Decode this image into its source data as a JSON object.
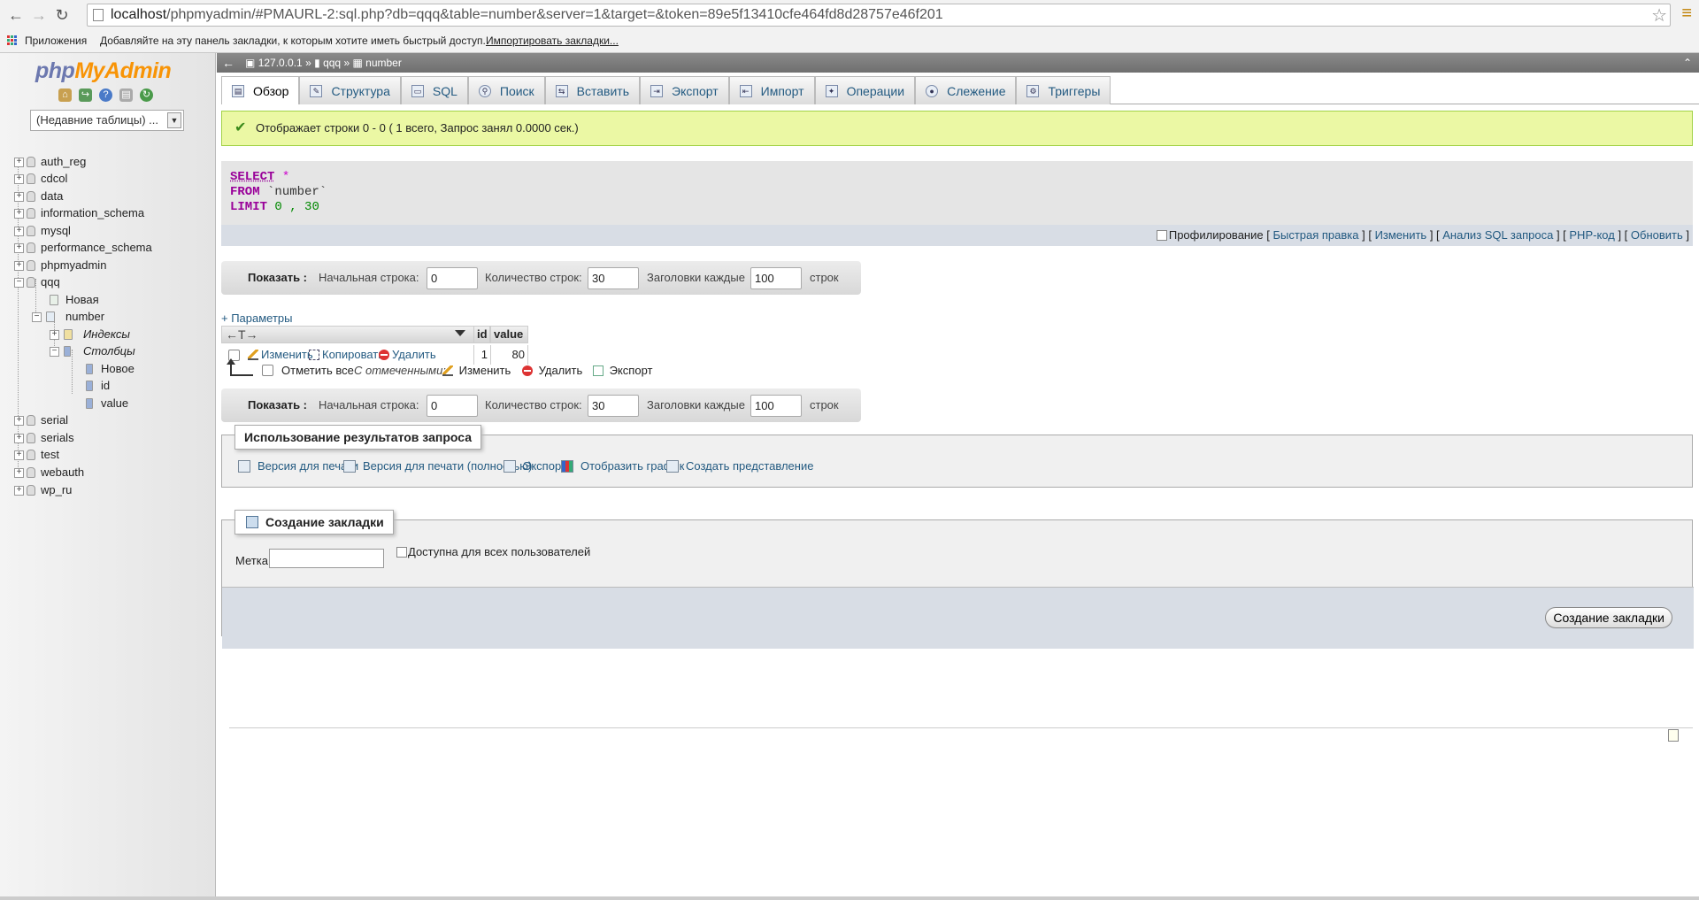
{
  "browser": {
    "url_host": "localhost",
    "url_path": "/phpmyadmin/#PMAURL-2:sql.php?db=qqq&table=number&server=1&target=&token=89e5f13410cfe464fd8d28757e46f201",
    "bookmarks": {
      "apps_label": "Приложения",
      "hint": "Добавляйте на эту панель закладки, к которым хотите иметь быстрый доступ.",
      "import_link": "Импортировать закладки..."
    }
  },
  "sidebar": {
    "logo_php": "php",
    "logo_myadmin": "MyAdmin",
    "recent_tables": "(Недавние таблицы) ...",
    "databases": [
      {
        "name": "auth_reg"
      },
      {
        "name": "cdcol"
      },
      {
        "name": "data"
      },
      {
        "name": "information_schema"
      },
      {
        "name": "mysql"
      },
      {
        "name": "performance_schema"
      },
      {
        "name": "phpmyadmin"
      },
      {
        "name": "qqq"
      },
      {
        "name": "serial"
      },
      {
        "name": "serials"
      },
      {
        "name": "test"
      },
      {
        "name": "webauth"
      },
      {
        "name": "wp_ru"
      }
    ],
    "qqq_children": {
      "new_label": "Новая",
      "table": "number",
      "indexes": "Индексы",
      "columns": "Столбцы",
      "column_new": "Новое",
      "column_items": [
        "id",
        "value"
      ]
    }
  },
  "breadcrumb": {
    "server": "127.0.0.1",
    "sep": "»",
    "database": "qqq",
    "table": "number"
  },
  "tabs": [
    {
      "label": "Обзор",
      "icon": "browse-icon",
      "active": true
    },
    {
      "label": "Структура",
      "icon": "structure-icon"
    },
    {
      "label": "SQL",
      "icon": "sql-icon"
    },
    {
      "label": "Поиск",
      "icon": "search-icon"
    },
    {
      "label": "Вставить",
      "icon": "insert-icon"
    },
    {
      "label": "Экспорт",
      "icon": "export-icon"
    },
    {
      "label": "Импорт",
      "icon": "import-icon"
    },
    {
      "label": "Операции",
      "icon": "wrench-icon"
    },
    {
      "label": "Слежение",
      "icon": "eye-icon"
    },
    {
      "label": "Триггеры",
      "icon": "triggers-icon"
    }
  ],
  "message": "Отображает строки 0 - 0 ( 1 всего, Запрос занял 0.0000 сек.)",
  "sql": {
    "line1_kw": "SELECT",
    "line1_rest": "*",
    "line2_kw": "FROM",
    "line2_rest": "`number`",
    "line3_kw": "LIMIT",
    "line3_a": "0",
    "line3_sep": ",",
    "line3_b": "30"
  },
  "sql_options": {
    "profiling": "Профилирование",
    "quick_edit": "Быстрая правка",
    "edit": "Изменить",
    "explain": "Анализ SQL запроса",
    "php_code": "PHP-код",
    "refresh": "Обновить"
  },
  "navbar": {
    "show": "Показать :",
    "start_row_label": "Начальная строка:",
    "start_row": "0",
    "rows_label": "Количество строк:",
    "rows": "30",
    "headers_label": "Заголовки каждые",
    "headers_every": "100",
    "rows_suffix": "строк"
  },
  "params_link": "+ Параметры",
  "results": {
    "nav_arrows": "←T→",
    "columns": [
      "id",
      "value"
    ],
    "rows": [
      {
        "id": "1",
        "value": "80"
      }
    ],
    "actions": {
      "edit": "Изменить",
      "copy": "Копировать",
      "delete": "Удалить"
    }
  },
  "bulk": {
    "check_all": "Отметить все",
    "with_selected": "С отмеченными:",
    "edit": "Изменить",
    "delete": "Удалить",
    "export": "Экспорт"
  },
  "query_results_ops": {
    "legend": "Использование результатов запроса",
    "links": [
      "Версия для печати",
      "Версия для печати (полностью)",
      "Экспорт",
      "Отобразить график",
      "Создать представление"
    ]
  },
  "bookmark": {
    "legend": "Создание закладки",
    "label": "Метка:",
    "label_value": "",
    "public": "Доступна для всех пользователей",
    "submit": "Создание закладки"
  },
  "colors": {
    "link": "#235a81",
    "success_bg": "#ebf8a4",
    "sql_keyword": "#990099"
  }
}
